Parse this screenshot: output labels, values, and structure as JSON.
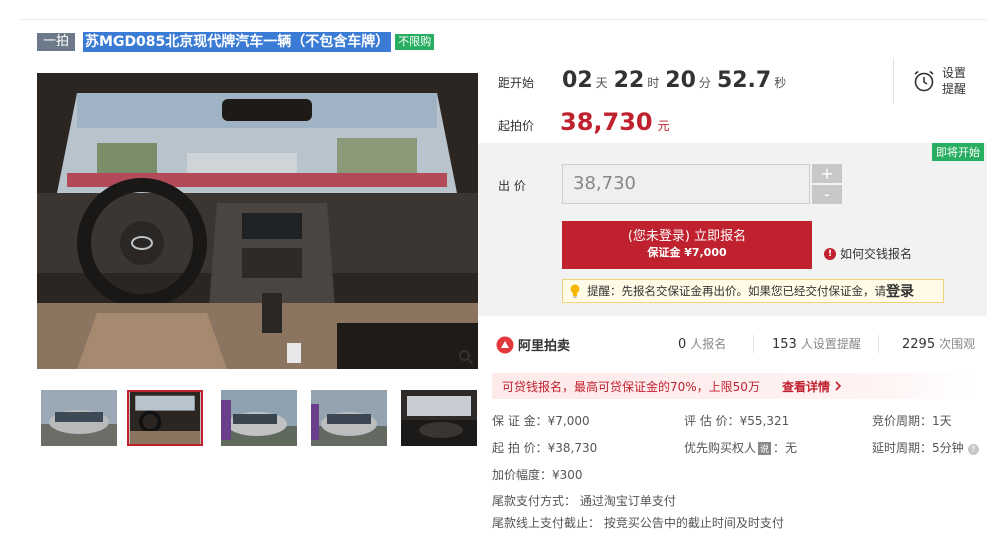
{
  "title": {
    "round_tag": "一拍",
    "text": "苏MGD085北京现代牌汽车一辆（不包含车牌）",
    "unlimited_tag": "不限购"
  },
  "icons": [
    "zoom-icon",
    "alarm-clock-icon",
    "auction-logo-icon",
    "info-icon",
    "lightbulb-icon",
    "chevron-right-icon",
    "question-icon"
  ],
  "countdown": {
    "label": "距开始",
    "days": "02",
    "days_unit": "天",
    "hours": "22",
    "hours_unit": "时",
    "minutes": "20",
    "minutes_unit": "分",
    "seconds": "52.7",
    "seconds_unit": "秒"
  },
  "reminder": {
    "line1": "设置",
    "line2": "提醒"
  },
  "start_price": {
    "label": "起拍价",
    "value": "38,730",
    "unit": "元"
  },
  "bid": {
    "soon_tag": "即将开始",
    "label": "出 价",
    "input_value": "38,730",
    "plus": "+",
    "minus": "-",
    "register_main": "(您未登录) 立即报名",
    "register_sub": "保证金 ¥7,000",
    "howto": "如何交钱报名",
    "tip_text": "提醒：先报名交保证金再出价。如果您已经交付保证金，请",
    "tip_login": "登录"
  },
  "stats": {
    "brand": "阿里拍卖",
    "signups": "0",
    "signups_unit": "人报名",
    "reminders": "153",
    "reminders_unit": "人设置提醒",
    "views": "2295",
    "views_unit": "次围观"
  },
  "promo": {
    "text": "可贷钱报名，最高可贷保证金的70%，上限50万",
    "link": "查看详情"
  },
  "details": {
    "deposit": "保 证 金：¥7,000",
    "appraisal": "评 估 价：¥55,321",
    "bid_cycle": "竞价周期：1天",
    "start": "起 拍 价：¥38,730",
    "priority_label": "优先购买权人",
    "priority_badge": "说",
    "priority_value": "：无",
    "delay_cycle": "延时周期：5分钟",
    "increment": "加价幅度：¥300",
    "payment_method": "尾款支付方式：  通过淘宝订单支付",
    "payment_deadline": "尾款线上支付截止：  按竞买公告中的截止时间及时支付"
  },
  "colors": {
    "accent_red": "#c0212e",
    "tag_green": "#27ae60",
    "title_blue": "#3a7bd5"
  }
}
